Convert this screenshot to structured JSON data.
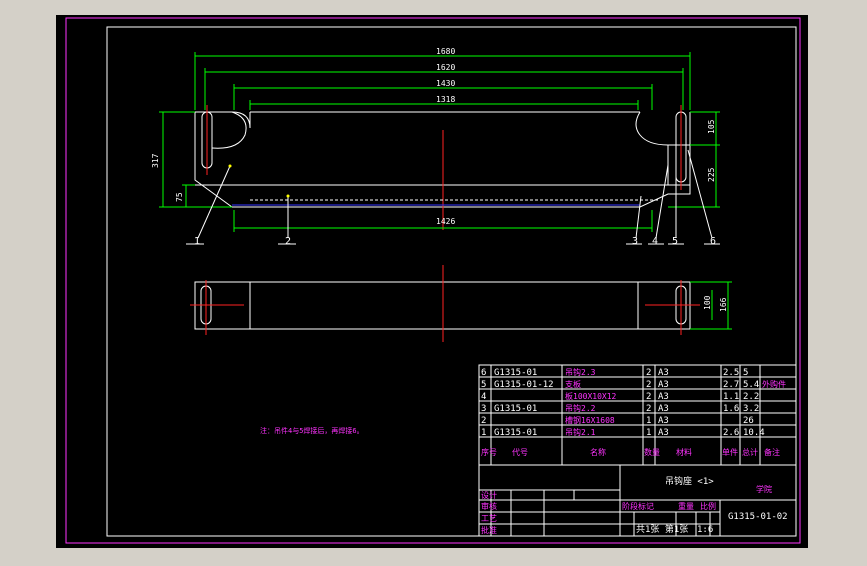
{
  "drawing": {
    "dimensions": {
      "d1680": "1680",
      "d1620": "1620",
      "d1430": "1430",
      "d1318": "1318",
      "d1426": "1426",
      "d317": "317",
      "d75": "75",
      "d105": "105",
      "d225": "225",
      "d100": "100",
      "d166": "166"
    },
    "part_markers": [
      "1",
      "2",
      "3",
      "4",
      "5",
      "6"
    ],
    "note": "注：吊件4与5焊接后，再焊接6。"
  },
  "parts_list": [
    {
      "no": "6",
      "code": "G1315-01",
      "name": "吊钩2.3",
      "qty": "2",
      "mat": "A3",
      "w1": "2.5",
      "w2": "5",
      "remark": ""
    },
    {
      "no": "5",
      "code": "G1315-01-12",
      "name": "支板",
      "qty": "2",
      "mat": "A3",
      "w1": "2.7",
      "w2": "5.4",
      "remark": "外购件"
    },
    {
      "no": "4",
      "code": "",
      "name": "板100X10X12",
      "qty": "2",
      "mat": "A3",
      "w1": "1.1",
      "w2": "2.2",
      "remark": ""
    },
    {
      "no": "3",
      "code": "G1315-01",
      "name": "吊钩2.2",
      "qty": "2",
      "mat": "A3",
      "w1": "1.6",
      "w2": "3.2",
      "remark": ""
    },
    {
      "no": "2",
      "code": "",
      "name": "槽钢16X1608",
      "qty": "1",
      "mat": "A3",
      "w1": "",
      "w2": "26",
      "remark": ""
    },
    {
      "no": "1",
      "code": "G1315-01",
      "name": "吊钩2.1",
      "qty": "1",
      "mat": "A3",
      "w1": "2.6",
      "w2": "10.4",
      "remark": ""
    }
  ],
  "parts_header": {
    "no": "序号",
    "code": "代号",
    "name": "名称",
    "qty": "数量",
    "mat": "材料",
    "w1": "单件",
    "w2": "总计",
    "remark": "备注"
  },
  "title_block": {
    "title": "吊钩座 <1>",
    "drawing_no": "G1315-01-02",
    "sheet_info": "共1张 第1张",
    "scale": "1:6",
    "school": "学院",
    "rows": [
      "设计",
      "审核",
      "工艺",
      "批准"
    ],
    "stage": "阶段标记",
    "weight": "重量",
    "ratio": "比例"
  }
}
